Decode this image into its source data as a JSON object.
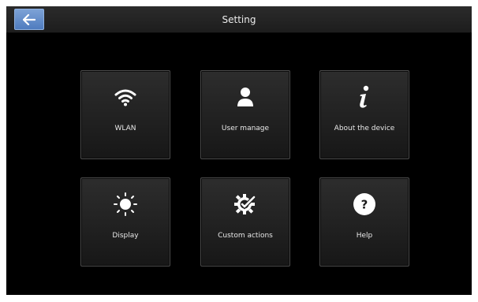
{
  "window": {
    "title": "Setting"
  },
  "header": {
    "back_icon": "arrow-left-icon"
  },
  "tiles": [
    {
      "label": "WLAN",
      "icon": "wifi-icon"
    },
    {
      "label": "User manage",
      "icon": "user-icon"
    },
    {
      "label": "About the device",
      "icon": "info-icon"
    },
    {
      "label": "Display",
      "icon": "brightness-icon"
    },
    {
      "label": "Custom actions",
      "icon": "gear-check-icon"
    },
    {
      "label": "Help",
      "icon": "help-icon",
      "glyph": "?"
    }
  ],
  "colors": {
    "background": "#000000",
    "accent": "#5d89c9",
    "tile": "#222222",
    "text": "#e8e8e8"
  }
}
